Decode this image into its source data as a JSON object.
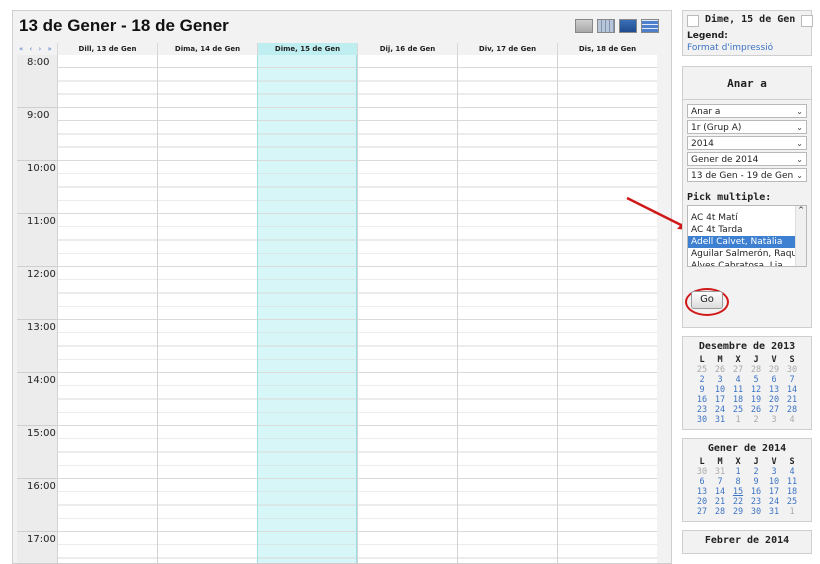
{
  "header": {
    "title": "13 de Gener - 18 de Gener",
    "nav_arrows": "« ‹ › »"
  },
  "week": {
    "columns": [
      {
        "label": "Dill, 13 de Gen"
      },
      {
        "label": "Dima, 14 de Gen"
      },
      {
        "label": "Dime, 15 de Gen",
        "today": true
      },
      {
        "label": "Dij, 16 de Gen"
      },
      {
        "label": "Div, 17 de Gen"
      },
      {
        "label": "Dis, 18 de Gen"
      }
    ],
    "hours": [
      "8:00",
      "9:00",
      "10:00",
      "11:00",
      "12:00",
      "13:00",
      "14:00",
      "15:00",
      "16:00",
      "17:00"
    ]
  },
  "sidebar": {
    "current_date": "Dime, 15 de Gen",
    "legend_label": "Legend:",
    "print_link": "Format d'impressió",
    "goto_title": "Anar a",
    "selects": [
      {
        "value": "Anar a"
      },
      {
        "value": "1r (Grup A)"
      },
      {
        "value": "2014"
      },
      {
        "value": "Gener de 2014"
      },
      {
        "value": "13 de Gen - 19 de Gen"
      }
    ],
    "pick_multiple_label": "Pick multiple:",
    "pick_items": [
      "AC 4t Matí",
      "AC 4t Tarda",
      "Adell Calvet, Natàlia",
      "Aguilar Salmerón, Raqu",
      "Alves Cabratosa, Lia"
    ],
    "pick_selected_index": 2,
    "go_label": "Go"
  },
  "minicals": [
    {
      "title": "Desembre de 2013",
      "weekdays": [
        "L",
        "M",
        "X",
        "J",
        "V",
        "S"
      ],
      "weeks": [
        [
          [
            "25",
            "o"
          ],
          [
            "26",
            "o"
          ],
          [
            "27",
            "o"
          ],
          [
            "28",
            "o"
          ],
          [
            "29",
            "o"
          ],
          [
            "30",
            "o"
          ]
        ],
        [
          [
            "2",
            "d"
          ],
          [
            "3",
            "d"
          ],
          [
            "4",
            "d"
          ],
          [
            "5",
            "d"
          ],
          [
            "6",
            "d"
          ],
          [
            "7",
            "d"
          ]
        ],
        [
          [
            "9",
            "d"
          ],
          [
            "10",
            "d"
          ],
          [
            "11",
            "d"
          ],
          [
            "12",
            "d"
          ],
          [
            "13",
            "d"
          ],
          [
            "14",
            "d"
          ]
        ],
        [
          [
            "16",
            "d"
          ],
          [
            "17",
            "d"
          ],
          [
            "18",
            "d"
          ],
          [
            "19",
            "d"
          ],
          [
            "20",
            "d"
          ],
          [
            "21",
            "d"
          ]
        ],
        [
          [
            "23",
            "d"
          ],
          [
            "24",
            "d"
          ],
          [
            "25",
            "d"
          ],
          [
            "26",
            "d"
          ],
          [
            "27",
            "d"
          ],
          [
            "28",
            "d"
          ]
        ],
        [
          [
            "30",
            "d"
          ],
          [
            "31",
            "d"
          ],
          [
            "1",
            "o"
          ],
          [
            "2",
            "o"
          ],
          [
            "3",
            "o"
          ],
          [
            "4",
            "o"
          ]
        ]
      ]
    },
    {
      "title": "Gener de 2014",
      "weekdays": [
        "L",
        "M",
        "X",
        "J",
        "V",
        "S"
      ],
      "weeks": [
        [
          [
            "30",
            "o"
          ],
          [
            "31",
            "o"
          ],
          [
            "1",
            "d"
          ],
          [
            "2",
            "d"
          ],
          [
            "3",
            "d"
          ],
          [
            "4",
            "d"
          ]
        ],
        [
          [
            "6",
            "d"
          ],
          [
            "7",
            "d"
          ],
          [
            "8",
            "d"
          ],
          [
            "9",
            "d"
          ],
          [
            "10",
            "d"
          ],
          [
            "11",
            "d"
          ]
        ],
        [
          [
            "13",
            "d"
          ],
          [
            "14",
            "d"
          ],
          [
            "15",
            "t"
          ],
          [
            "16",
            "d"
          ],
          [
            "17",
            "d"
          ],
          [
            "18",
            "d"
          ]
        ],
        [
          [
            "20",
            "d"
          ],
          [
            "21",
            "d"
          ],
          [
            "22",
            "d"
          ],
          [
            "23",
            "d"
          ],
          [
            "24",
            "d"
          ],
          [
            "25",
            "d"
          ]
        ],
        [
          [
            "27",
            "d"
          ],
          [
            "28",
            "d"
          ],
          [
            "29",
            "d"
          ],
          [
            "30",
            "d"
          ],
          [
            "31",
            "d"
          ],
          [
            "1",
            "o"
          ]
        ]
      ]
    },
    {
      "title": "Febrer de 2014",
      "weekdays": [],
      "weeks": []
    }
  ],
  "colors": {
    "today_column": "#d7f6f7",
    "link": "#3d73c5",
    "selected": "#3d7fd0",
    "annotation": "#d01818"
  }
}
